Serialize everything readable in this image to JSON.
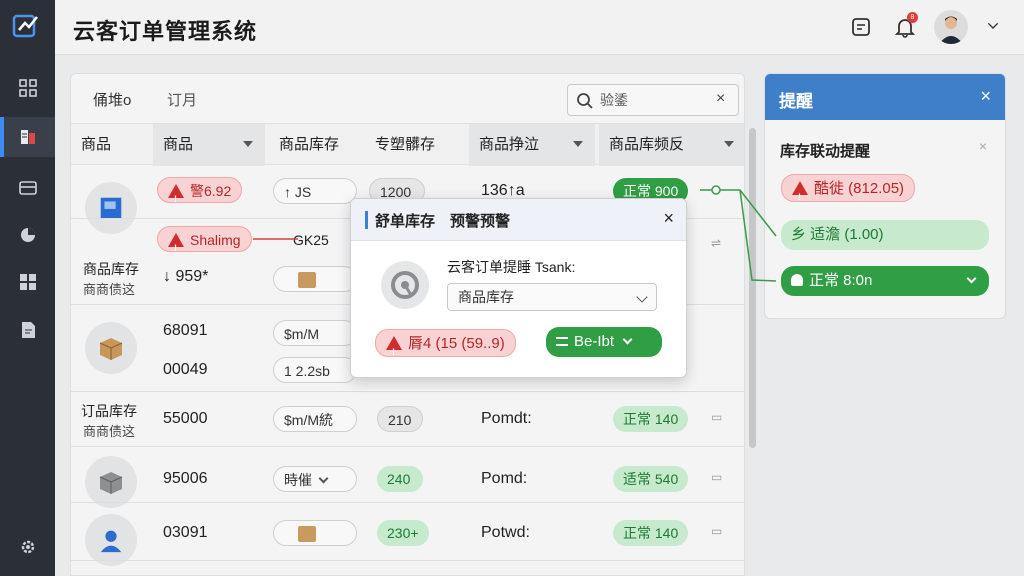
{
  "app": {
    "title": "云客订单管理系统"
  },
  "header": {
    "notif_count": "8"
  },
  "tabs": [
    {
      "label": "俑堆o"
    },
    {
      "label": "订月"
    }
  ],
  "search": {
    "value": "验鋈",
    "clear": "×"
  },
  "table": {
    "columns": [
      "商品",
      "商品",
      "商品库存",
      "专塑髒存",
      "商品挣泣",
      "商品库频反"
    ],
    "rows": [
      {
        "badge": "警6.92",
        "stock_tag": "↑ JS",
        "qty": "1200",
        "flow": "136↑a",
        "status": "正常 900"
      },
      {
        "badge": "Shalimg",
        "stock_tag": "GK25",
        "qty": "",
        "flow": "",
        "status": ""
      },
      {
        "name_line1": "商品库存",
        "name_line2": "商商债这",
        "code": "↓ 959*",
        "stock_tag": "",
        "qty": "",
        "flow": "",
        "status": ""
      },
      {
        "code": "68091",
        "stock_tag": "$m/M",
        "qty": "",
        "flow": "",
        "status": ""
      },
      {
        "code": "00049",
        "stock_tag": "1 2.2sb",
        "qty": "",
        "flow": "",
        "status": ""
      },
      {
        "name_line1": "订品库存",
        "name_line2": "商商债这",
        "code": "55000",
        "stock_tag": "$m/M統",
        "qty": "210",
        "flow": "Pomdt:",
        "status": "正常 140"
      },
      {
        "code": "95006",
        "stock_tag": "時催",
        "qty": "240",
        "flow": "Pomd:",
        "status": "适常 540"
      },
      {
        "code": "03091",
        "stock_tag": "",
        "qty": "230+",
        "flow": "Potwd:",
        "status": "正常 140"
      }
    ]
  },
  "panel": {
    "title": "提醒",
    "close": "×",
    "subtitle": "库存联动提醒",
    "subclose": "×",
    "items": [
      {
        "label": "酷徙 (812.05)"
      },
      {
        "label": "乡 适澹 (1.00)"
      },
      {
        "label": "正常 8:0n"
      }
    ]
  },
  "modal": {
    "title": "舒单库存　预警预警",
    "close": "×",
    "label": "云客订单提睡 Tsank:",
    "select_value": "商品库存",
    "warn_label": "脣4 (15 (59..9)",
    "action_label": "Be-Ibt"
  },
  "colors": {
    "accent": "#3f7fc9",
    "danger": "#d12d2d",
    "success": "#2f9e44",
    "rail": "#2b3038"
  }
}
